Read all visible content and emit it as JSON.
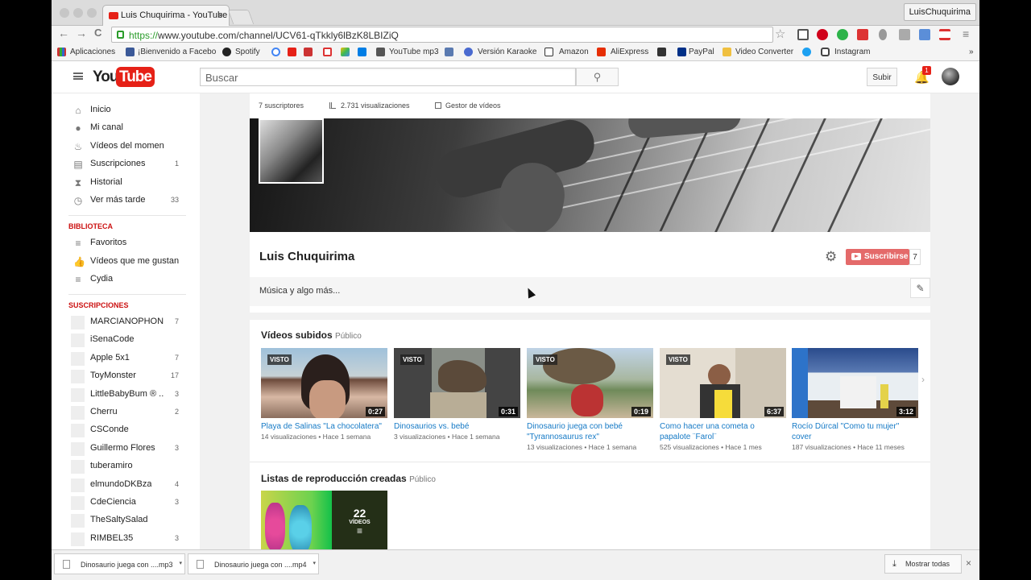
{
  "browser": {
    "tab_title": "Luis Chuquirima - YouTube",
    "tab_close": "×",
    "user_button": "LuisChuquirima",
    "url_scheme": "https://",
    "url_rest": "www.youtube.com/channel/UCV61-qTkkly6lBzK8LBIZiQ",
    "back": "←",
    "forward": "→",
    "reload": "C",
    "star": "☆",
    "menu": "≡"
  },
  "bookmarks": {
    "apps": "Aplicaciones",
    "facebook": "¡Bienvenido a Facebo",
    "spotify": "Spotify",
    "ytmp3": "YouTube mp3",
    "karaoke": "Versión Karaoke",
    "amazon": "Amazon",
    "aliexpress": "AliExpress",
    "paypal": "PayPal",
    "converter": "Video Converter",
    "instagram": "Instagram",
    "more": "»"
  },
  "header": {
    "logo_you": "You",
    "logo_tube": "Tube",
    "search_placeholder": "Buscar",
    "search_icon": "⚲",
    "upload": "Subir",
    "bell": "🔔",
    "notifications": "1"
  },
  "sidebar": {
    "main": [
      {
        "label": "Inicio",
        "icon": "⌂",
        "count": ""
      },
      {
        "label": "Mi canal",
        "icon": "●",
        "count": ""
      },
      {
        "label": "Vídeos del momento",
        "icon": "♨",
        "count": ""
      },
      {
        "label": "Suscripciones",
        "icon": "▤",
        "count": "1"
      },
      {
        "label": "Historial",
        "icon": "⧗",
        "count": ""
      },
      {
        "label": "Ver más tarde",
        "icon": "◷",
        "count": "33"
      }
    ],
    "library_heading": "BIBLIOTECA",
    "library": [
      {
        "label": "Favoritos",
        "icon": "≡"
      },
      {
        "label": "Vídeos que me gustan",
        "icon": "👍"
      },
      {
        "label": "Cydia",
        "icon": "≡"
      }
    ],
    "subs_heading": "SUSCRIPCIONES",
    "subscriptions": [
      {
        "label": "MARCIANOPHON..",
        "count": "7"
      },
      {
        "label": "iSenaCode",
        "count": ""
      },
      {
        "label": "Apple 5x1",
        "count": "7"
      },
      {
        "label": "ToyMonster",
        "count": "17"
      },
      {
        "label": "LittleBabyBum ® ...",
        "count": "3"
      },
      {
        "label": "Cherru",
        "count": "2"
      },
      {
        "label": "CSConde",
        "count": ""
      },
      {
        "label": "Guillermo Flores",
        "count": "3"
      },
      {
        "label": "tuberamiro",
        "count": ""
      },
      {
        "label": "elmundoDKBza",
        "count": "4"
      },
      {
        "label": "CdeCiencia",
        "count": "3"
      },
      {
        "label": "TheSaltySalad",
        "count": ""
      },
      {
        "label": "RIMBEL35",
        "count": "3"
      }
    ]
  },
  "channel": {
    "subscribers": "7 suscriptores",
    "views": "2.731 visualizaciones",
    "manager": "Gestor de vídeos",
    "name": "Luis Chuquirima",
    "gear": "⚙",
    "subscribe": "Suscribirse",
    "sub_count": "7",
    "description": "Música y algo más...",
    "edit": "✎"
  },
  "uploads": {
    "title": "Vídeos subidos",
    "visibility": "Público",
    "next": "›",
    "videos": [
      {
        "title": "Playa de Salinas \"La chocolatera\"",
        "meta": "14 visualizaciones • Hace 1 semana",
        "duration": "0:27",
        "badge": "VISTO"
      },
      {
        "title": "Dinosaurios vs. bebé",
        "meta": "3 visualizaciones • Hace 1 semana",
        "duration": "0:31",
        "badge": "VISTO"
      },
      {
        "title": "Dinosaurio juega con bebé \"Tyrannosaurus rex\"",
        "meta": "13 visualizaciones • Hace 1 semana",
        "duration": "0:19",
        "badge": "VISTO"
      },
      {
        "title": "Como hacer una cometa o papalote ¨Farol¨",
        "meta": "525 visualizaciones • Hace 1 mes",
        "duration": "6:37",
        "badge": "VISTO"
      },
      {
        "title": "Rocío Dúrcal \"Como tu mujer\" cover",
        "meta": "187 visualizaciones • Hace 11 meses",
        "duration": "3:12",
        "badge": ""
      }
    ]
  },
  "playlists": {
    "title": "Listas de reproducción creadas",
    "visibility": "Público",
    "count": "22",
    "count_label": "VÍDEOS",
    "list_icon": "≡"
  },
  "downloads": {
    "items": [
      {
        "label": "Dinosaurio juega con ....mp3"
      },
      {
        "label": "Dinosaurio juega con ....mp4"
      }
    ],
    "show_all": "Mostrar todas",
    "close": "×",
    "arrow": "▾"
  }
}
